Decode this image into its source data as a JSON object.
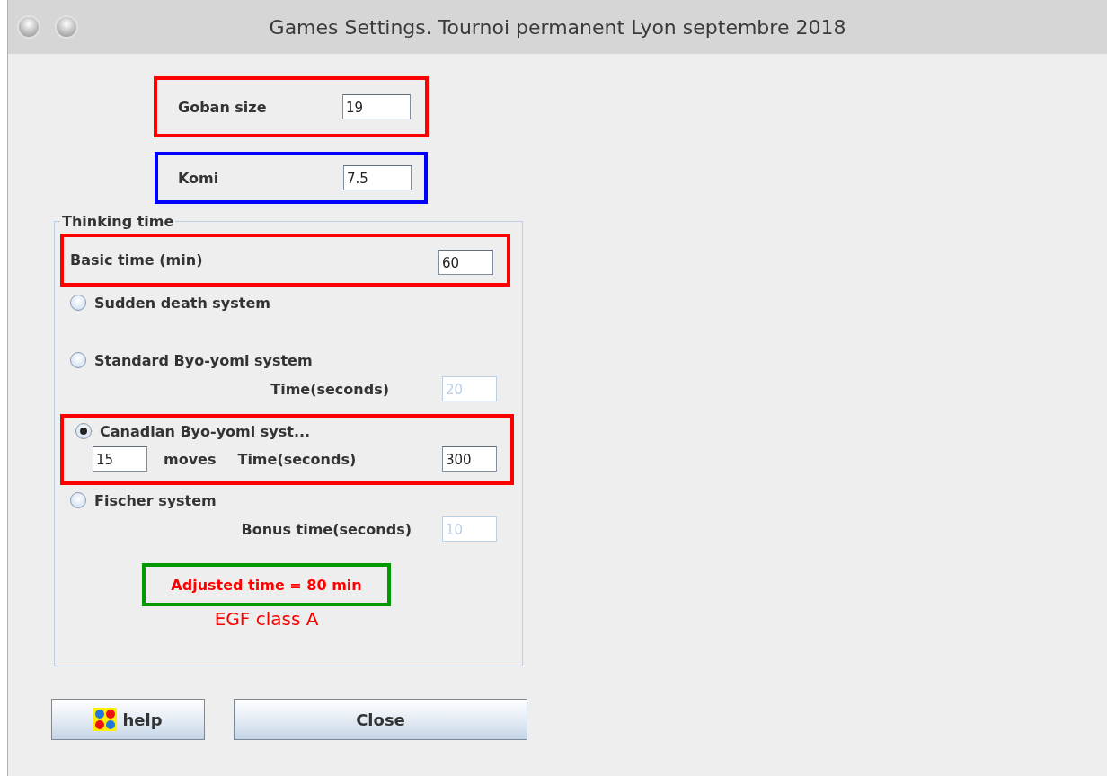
{
  "window": {
    "title": "Games Settings. Tournoi permanent Lyon septembre 2018"
  },
  "goban_size": {
    "label": "Goban size",
    "value": "19",
    "color": "#ff0000"
  },
  "komi": {
    "label": "Komi",
    "value": "7.5",
    "color": "#0000ff"
  },
  "thinking_time": {
    "title": "Thinking time",
    "basic_time": {
      "label": "Basic time (min)",
      "value": "60",
      "color": "#ff0000"
    },
    "systems": [
      {
        "kind": "sudden_death",
        "label": "Sudden death system",
        "selected": false
      },
      {
        "kind": "standard",
        "label": "Standard Byo-yomi system",
        "selected": false,
        "time_label": "Time(seconds)",
        "time_value": "20",
        "disabled": true
      },
      {
        "kind": "canadian",
        "label": "Canadian Byo-yomi syst...",
        "selected": true,
        "moves_value": "15",
        "moves_label": "moves",
        "time_label": "Time(seconds)",
        "time_value": "300",
        "disabled": false,
        "color": "#ff0000"
      },
      {
        "kind": "fischer",
        "label": "Fischer system",
        "selected": false,
        "time_label": "Bonus time(seconds)",
        "time_value": "10",
        "disabled": true
      }
    ],
    "adjusted_time": {
      "text": "Adjusted time = 80 min",
      "color": "#009900"
    },
    "egf_class": "EGF class A"
  },
  "buttons": [
    {
      "kind": "help",
      "label": "help"
    },
    {
      "kind": "close",
      "label": "Close"
    }
  ]
}
